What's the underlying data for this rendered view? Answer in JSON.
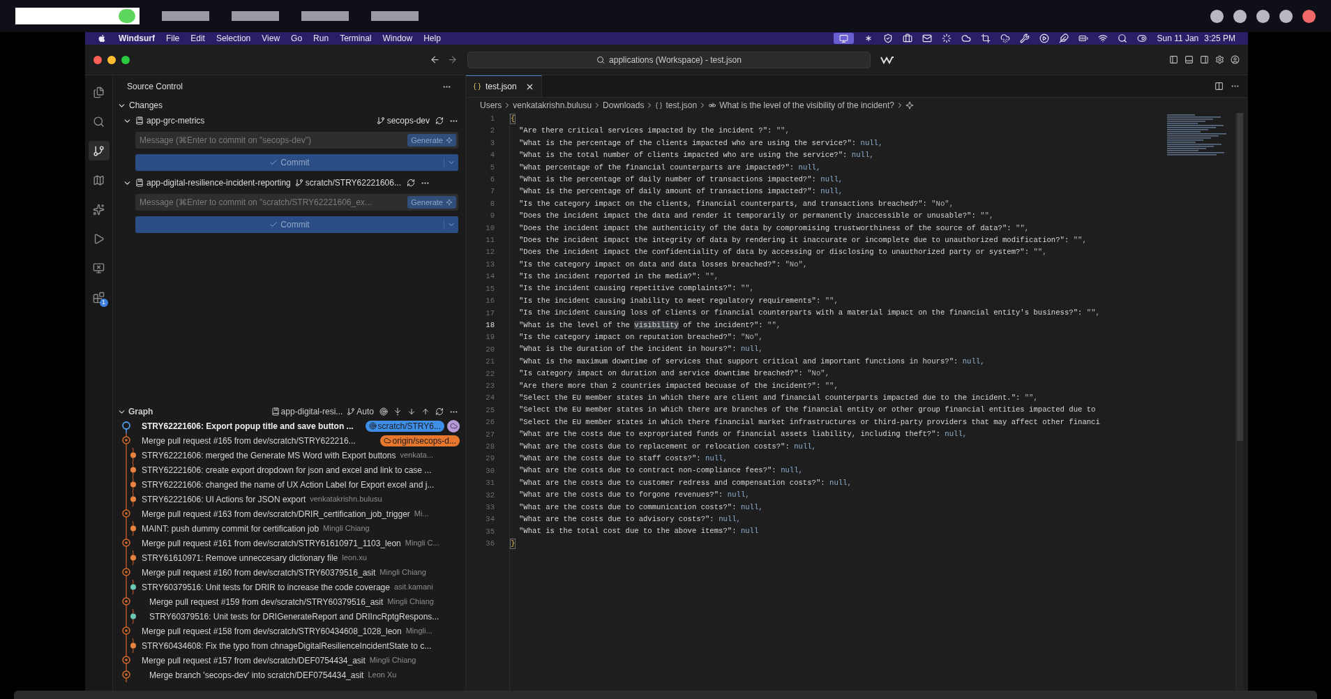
{
  "menu_bar": {
    "app": "Windsurf",
    "menus": [
      "File",
      "Edit",
      "Selection",
      "View",
      "Go",
      "Run",
      "Terminal",
      "Window",
      "Help"
    ],
    "date": "Sun 11 Jan",
    "time": "3:25 PM"
  },
  "title_bar": {
    "search": "applications (Workspace) - test.json"
  },
  "activity_bar": {
    "items": [
      {
        "kind": "files",
        "selected": false
      },
      {
        "kind": "search",
        "selected": false
      },
      {
        "kind": "source_control",
        "selected": true
      },
      {
        "kind": "map",
        "selected": false
      },
      {
        "kind": "sparkle",
        "selected": false
      },
      {
        "kind": "run",
        "selected": false
      },
      {
        "kind": "remote",
        "selected": false
      },
      {
        "kind": "extensions",
        "selected": false,
        "badge": "1"
      }
    ]
  },
  "source_control": {
    "title": "Source Control",
    "changes": {
      "label": "Changes",
      "expanded": true
    },
    "repos": [
      {
        "name": "app-grc-metrics",
        "branch": "secops-dev",
        "expanded": true,
        "placeholder": "Message (⌘Enter to commit on \"secops-dev\")",
        "generate": "Generate",
        "commit": "Commit"
      },
      {
        "name": "app-digital-resilience-incident-reporting",
        "branch": "scratch/STRY62221606...",
        "expanded": true,
        "placeholder": "Message (⌘Enter to commit on \"scratch/STRY62221606_ex...",
        "generate": "Generate",
        "commit": "Commit"
      }
    ]
  },
  "graph": {
    "title": "Graph",
    "expanded": true,
    "repo": "app-digital-resi...",
    "mode": "Auto",
    "commits": [
      {
        "kind": "head",
        "color": "#4f9be8",
        "indented": false,
        "message": "STRY62221606: Export popup title and save button ...",
        "badges": [
          {
            "kind": "local",
            "label": "scratch/STRY6...",
            "color": "#3f8ee8"
          },
          {
            "kind": "cloud",
            "color": "#b59ad6"
          }
        ]
      },
      {
        "kind": "merge",
        "color": "#d96c2c",
        "indented": false,
        "message": "Merge pull request #165 from dev/scratch/STRY622216...",
        "badges": [
          {
            "kind": "remote",
            "label": "origin/secops-d...",
            "color": "#e8772e"
          }
        ]
      },
      {
        "kind": "commit",
        "color": "#e8843f",
        "indented": false,
        "message": "STRY62221606: merged the Generate MS Word with Export buttons",
        "author": "venkata..."
      },
      {
        "kind": "commit",
        "color": "#e8843f",
        "indented": false,
        "message": "STRY62221606: create export dropdown for json and excel and link to case ..."
      },
      {
        "kind": "commit",
        "color": "#e8843f",
        "indented": false,
        "message": "STRY62221606: changed the name of UX Action Label for Export excel and j..."
      },
      {
        "kind": "commit",
        "color": "#e8843f",
        "indented": false,
        "message": "STRY62221606: UI Actions for JSON export",
        "author": "venkatakrishn.bulusu"
      },
      {
        "kind": "merge",
        "color": "#d96c2c",
        "indented": false,
        "message": "Merge pull request #163 from dev/scratch/DRIR_certification_job_trigger",
        "author": "Mi..."
      },
      {
        "kind": "commit",
        "color": "#e8843f",
        "indented": false,
        "message": "MAINT: push dummy commit for certification job",
        "author": "Mingli Chiang"
      },
      {
        "kind": "merge",
        "color": "#d96c2c",
        "indented": false,
        "message": "Merge pull request #161 from dev/scratch/STRY61610971_1103_leon",
        "author": "Mingli C..."
      },
      {
        "kind": "commit",
        "color": "#e8843f",
        "indented": false,
        "message": "STRY61610971: Remove unneccesary dictionary file",
        "author": "leon.xu"
      },
      {
        "kind": "merge",
        "color": "#d96c2c",
        "indented": false,
        "message": "Merge pull request #160 from dev/scratch/STRY60379516_asit",
        "author": "Mingli Chiang"
      },
      {
        "kind": "commit",
        "color": "#6cc5b5",
        "indented": false,
        "message": "STRY60379516: Unit tests for DRIR to increase the code coverage",
        "author": "asit.kamani"
      },
      {
        "kind": "merge",
        "color": "#d96c2c",
        "indented": true,
        "message": "Merge pull request #159 from dev/scratch/STRY60379516_asit",
        "author": "Mingli Chiang"
      },
      {
        "kind": "commit",
        "color": "#6cc5b5",
        "indented": true,
        "message": "STRY60379516: Unit tests for DRIGenerateReport and DRIIncRptgRespons..."
      },
      {
        "kind": "merge",
        "color": "#d96c2c",
        "indented": false,
        "message": "Merge pull request #158 from dev/scratch/STRY60434608_1028_leon",
        "author": "Mingli..."
      },
      {
        "kind": "commit",
        "color": "#e8843f",
        "indented": false,
        "message": "STRY60434608: Fix the typo from chnageDigitalResilienceIncidentState to c..."
      },
      {
        "kind": "merge",
        "color": "#d96c2c",
        "indented": false,
        "message": "Merge pull request #157 from dev/scratch/DEF0754434_asit",
        "author": "Mingli Chiang"
      },
      {
        "kind": "merge",
        "color": "#d96c2c",
        "indented": true,
        "message": "Merge branch 'secops-dev' into scratch/DEF0754434_asit",
        "author": "Leon Xu"
      }
    ]
  },
  "tabs": [
    {
      "label": "test.json",
      "selected": true
    }
  ],
  "breadcrumb": [
    {
      "kind": "folder",
      "label": "Users"
    },
    {
      "kind": "folder",
      "label": "venkatakrishn.bulusu"
    },
    {
      "kind": "folder",
      "label": "Downloads"
    },
    {
      "kind": "json",
      "label": "test.json"
    },
    {
      "kind": "string",
      "label": "What is the level of the visibility of the incident?"
    }
  ],
  "code": [
    {
      "n": "1",
      "kind": "brace",
      "text": "{",
      "current": false
    },
    {
      "n": "2",
      "kind": "string",
      "key": "\"Are there critical services impacted by the incident ?\":",
      "value": "\"\",",
      "current": false
    },
    {
      "n": "3",
      "kind": "null",
      "key": "\"What is the percentage of the clients impacted who are using the service?\":",
      "value": "null,",
      "current": false
    },
    {
      "n": "4",
      "kind": "null",
      "key": "\"What is the total number of clients impacted who are using the service?\":",
      "value": "null,",
      "current": false
    },
    {
      "n": "5",
      "kind": "null",
      "key": "\"What percentage of the financial counterparts are impacted?\":",
      "value": "null,",
      "current": false
    },
    {
      "n": "6",
      "kind": "null",
      "key": "\"What is the percentage of daily number of transactions impacted?\":",
      "value": "null,",
      "current": false
    },
    {
      "n": "7",
      "kind": "null",
      "key": "\"What is the percentage of daily amount of transactions impacted?\":",
      "value": "null,",
      "current": false
    },
    {
      "n": "8",
      "kind": "string",
      "key": "\"Is the category impact on the clients, financial counterparts, and transactions breached?\":",
      "value": "\"No\",",
      "current": false
    },
    {
      "n": "9",
      "kind": "string",
      "key": "\"Does the incident impact the data and render it temporarily or permanently inaccessible or unusable?\":",
      "value": "\"\",",
      "current": false
    },
    {
      "n": "10",
      "kind": "string",
      "key": "\"Does the incident impact the authenticity of the data by compromising trustworthiness of the source of data?\":",
      "value": "\"\",",
      "current": false
    },
    {
      "n": "11",
      "kind": "string",
      "key": "\"Does the incident impact the integrity of data by rendering it inaccurate or incomplete due to unauthorized modification?\":",
      "value": "\"\",",
      "current": false
    },
    {
      "n": "12",
      "kind": "string",
      "key": "\"Does the incident impact the confidentiality of data by accessing or disclosing to unauthorized party or system?\":",
      "value": "\"\",",
      "current": false
    },
    {
      "n": "13",
      "kind": "string",
      "key": "\"Is the category impact on data and data losses breached?\":",
      "value": "\"No\",",
      "current": false
    },
    {
      "n": "14",
      "kind": "string",
      "key": "\"Is the incident reported in the media?\":",
      "value": "\"\",",
      "current": false
    },
    {
      "n": "15",
      "kind": "string",
      "key": "\"Is the incident causing repetitive complaints?\":",
      "value": "\"\",",
      "current": false
    },
    {
      "n": "16",
      "kind": "string",
      "key": "\"Is the incident causing inability to meet regulatory requirements\":",
      "value": "\"\",",
      "current": false
    },
    {
      "n": "17",
      "kind": "string",
      "key": "\"Is the incident causing loss of clients or financial counterparts with a material impact on the financial entity's business?\":",
      "value": "\"\",",
      "current": false
    },
    {
      "n": "18",
      "kind": "string",
      "key": "\"What is the level of the",
      "match": "visibility",
      "key_rest": "of the incident?\":",
      "value": "\"\",",
      "current": true
    },
    {
      "n": "19",
      "kind": "string",
      "key": "\"Is the category impact on reputation breached?\":",
      "value": "\"No\",",
      "current": false
    },
    {
      "n": "20",
      "kind": "null",
      "key": "\"What is the duration of the incident in hours?\":",
      "value": "null,",
      "current": false
    },
    {
      "n": "21",
      "kind": "null",
      "key": "\"What is the maximum downtime of services that support critical and important functions in hours?\":",
      "value": "null,",
      "current": false
    },
    {
      "n": "22",
      "kind": "string",
      "key": "\"Is category impact on duration and service downtime breached?\":",
      "value": "\"No\",",
      "current": false
    },
    {
      "n": "23",
      "kind": "string",
      "key": "\"Are there more than 2 countries impacted becuase of the incident?\":",
      "value": "\"\",",
      "current": false
    },
    {
      "n": "24",
      "kind": "string",
      "key": "\"Select the EU member states in which there are client and financial counterparts impacted due to the incident.\":",
      "value": "\"\",",
      "current": false
    },
    {
      "n": "25",
      "kind": "cut",
      "key": "\"Select the EU member states in which there are branches of the financial entity or other group financial entities impacted due to",
      "current": false
    },
    {
      "n": "26",
      "kind": "cut",
      "key": "\"Select the EU member states in which there financial market infrastructures or third-party providers that may affect other financi",
      "current": false
    },
    {
      "n": "27",
      "kind": "null",
      "key": "\"What are the costs due to expropriated funds or financial assets liability, including theft?\":",
      "value": "null,",
      "current": false
    },
    {
      "n": "28",
      "kind": "null",
      "key": "\"What are the costs due to replacement or relocation costs?\":",
      "value": "null,",
      "current": false
    },
    {
      "n": "29",
      "kind": "null",
      "key": "\"What are the costs due to staff costs?\":",
      "value": "null,",
      "current": false
    },
    {
      "n": "30",
      "kind": "null",
      "key": "\"What are the costs due to contract non-compliance fees?\":",
      "value": "null,",
      "current": false
    },
    {
      "n": "31",
      "kind": "null",
      "key": "\"What are the costs due to customer redress and compensation costs?\":",
      "value": "null,",
      "current": false
    },
    {
      "n": "32",
      "kind": "null",
      "key": "\"What are the costs due to forgone revenues?\":",
      "value": "null,",
      "current": false
    },
    {
      "n": "33",
      "kind": "null",
      "key": "\"What are the costs due to communication costs?\":",
      "value": "null,",
      "current": false
    },
    {
      "n": "34",
      "kind": "null",
      "key": "\"What are the costs due to advisory costs?\":",
      "value": "null,",
      "current": false
    },
    {
      "n": "35",
      "kind": "null",
      "key": "\"What is the total cost due to the above items?\":",
      "value": "null",
      "current": false
    },
    {
      "n": "36",
      "kind": "brace",
      "text": "}",
      "current": false
    }
  ]
}
